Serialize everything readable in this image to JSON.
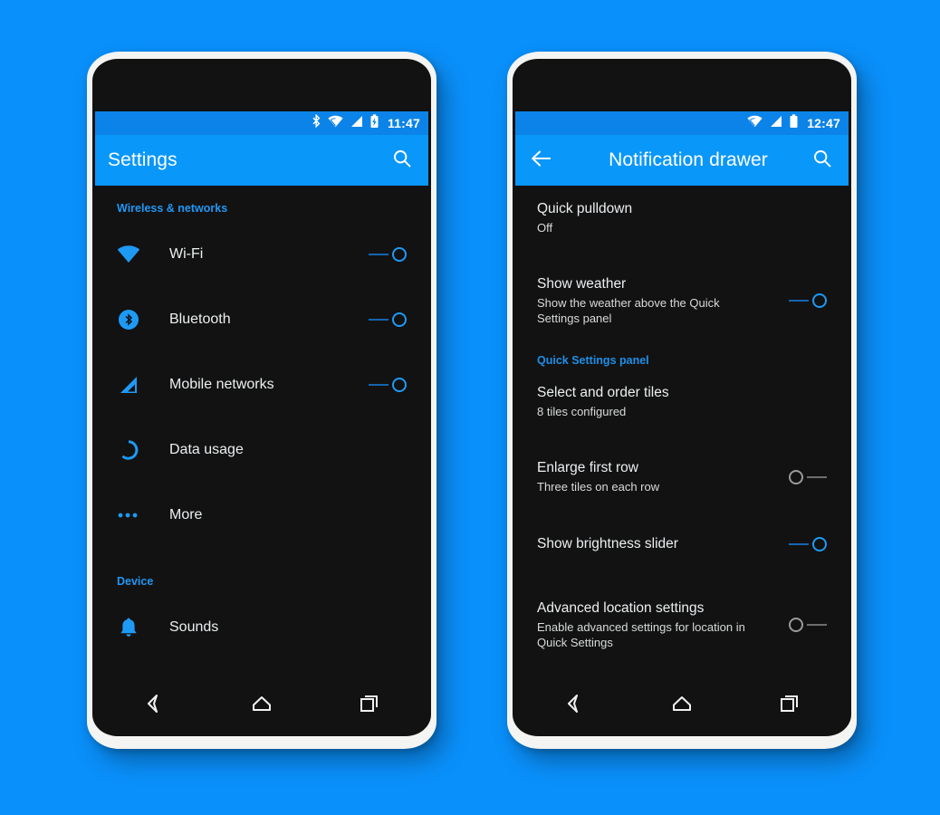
{
  "background_color": "#0a90fb",
  "accent_color": "#2196f3",
  "phones": [
    {
      "id": "settings-phone",
      "statusbar": {
        "time": "11:47",
        "icons": [
          "bluetooth-icon",
          "wifi-icon",
          "cell-signal-icon",
          "battery-charging-icon"
        ]
      },
      "appbar": {
        "title": "Settings",
        "has_back": false,
        "search_label": "search-icon"
      },
      "sections": [
        {
          "header": "Wireless & networks",
          "rows": [
            {
              "icon": "wifi-icon",
              "label": "Wi-Fi",
              "toggle": "on"
            },
            {
              "icon": "bluetooth-icon",
              "label": "Bluetooth",
              "toggle": "on"
            },
            {
              "icon": "cell-signal-icon",
              "label": "Mobile networks",
              "toggle": "on"
            },
            {
              "icon": "data-usage-icon",
              "label": "Data usage",
              "toggle": "none"
            },
            {
              "icon": "more-dots-icon",
              "label": "More",
              "toggle": "none"
            }
          ]
        },
        {
          "header": "Device",
          "rows": [
            {
              "icon": "bell-icon",
              "label": "Sounds",
              "toggle": "none"
            }
          ]
        }
      ],
      "navbar": [
        "back-icon",
        "home-icon",
        "recents-icon"
      ]
    },
    {
      "id": "notification-drawer-phone",
      "statusbar": {
        "time": "12:47",
        "icons": [
          "wifi-icon",
          "cell-signal-icon",
          "battery-full-icon"
        ]
      },
      "appbar": {
        "title": "Notification drawer",
        "has_back": true,
        "search_label": "search-icon"
      },
      "sections": [
        {
          "header": "",
          "rows": [
            {
              "title": "Quick pulldown",
              "subtitle": "Off",
              "toggle": "none"
            },
            {
              "title": "Show weather",
              "subtitle": "Show the weather above the Quick Settings panel",
              "toggle": "on"
            }
          ]
        },
        {
          "header": "Quick Settings panel",
          "rows": [
            {
              "title": "Select and order tiles",
              "subtitle": "8 tiles configured",
              "toggle": "none"
            },
            {
              "title": "Enlarge first row",
              "subtitle": "Three tiles on each row",
              "toggle": "off"
            },
            {
              "title": "Show brightness slider",
              "subtitle": "",
              "toggle": "on"
            },
            {
              "title": "Advanced location settings",
              "subtitle": "Enable advanced settings for location in Quick Settings",
              "toggle": "off"
            }
          ]
        }
      ],
      "navbar": [
        "back-icon",
        "home-icon",
        "recents-icon"
      ]
    }
  ]
}
